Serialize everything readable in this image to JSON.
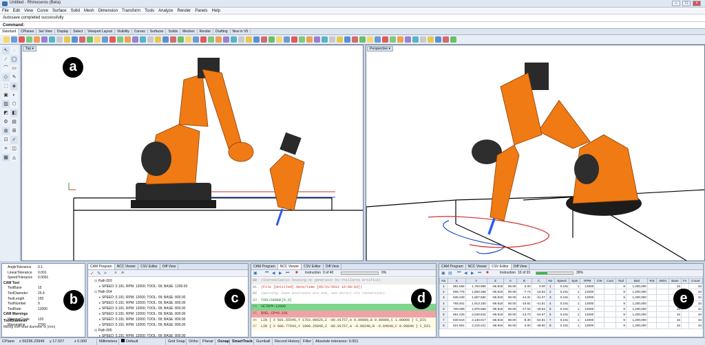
{
  "window": {
    "title": "Untitled - Rhinoceros (Beta)"
  },
  "menu": [
    "File",
    "Edit",
    "View",
    "Curve",
    "Surface",
    "Solid",
    "Mesh",
    "Dimension",
    "Transform",
    "Tools",
    "Analyze",
    "Render",
    "Panels",
    "Help"
  ],
  "command_history": "Autosave completed successfully",
  "command_prompt": "Command:",
  "toolbar_tabs": [
    "Standard",
    "CPlanes",
    "Set View",
    "Display",
    "Select",
    "Viewport Layout",
    "Visibility",
    "Curves",
    "Surfaces",
    "Solids",
    "Meshes",
    "Render",
    "Drafting",
    "New in V5"
  ],
  "viewports": {
    "left": "Top",
    "right": "Perspective"
  },
  "callouts": [
    "a",
    "b",
    "c",
    "d",
    "e"
  ],
  "properties": {
    "rows": [
      {
        "key": "AngleTolerance",
        "value": "0.1",
        "type": "row"
      },
      {
        "key": "LinearTolerance",
        "value": "0.001",
        "type": "row"
      },
      {
        "key": "SpeedTolerance",
        "value": "0.0001",
        "type": "row"
      },
      {
        "key": "CAM Tool",
        "value": "",
        "type": "sec"
      },
      {
        "key": "ToolBase",
        "value": "15",
        "type": "row"
      },
      {
        "key": "ToolDiameter",
        "value": "25.4",
        "type": "row"
      },
      {
        "key": "ToolLength",
        "value": "150",
        "type": "row"
      },
      {
        "key": "ToolNumber",
        "value": "9",
        "type": "row"
      },
      {
        "key": "ToolRate",
        "value": "12000",
        "type": "row"
      },
      {
        "key": "CAM Warnings",
        "value": "",
        "type": "sec"
      },
      {
        "key": "WarningCrank",
        "value": "120",
        "type": "row"
      },
      {
        "key": "WarningFar",
        "value": "2700",
        "type": "row"
      }
    ],
    "desc_title": "ToolDiameter",
    "desc_text": "Milling tool head diameter in (mm)"
  },
  "cam_panel": {
    "tabs": [
      "CAM Program",
      "NCC Viewer",
      "CSV Editor",
      "Diff View"
    ],
    "tree": [
      {
        "indent": 1,
        "text": "Path 003"
      },
      {
        "indent": 2,
        "text": "SPEED: 0.191; RPM: 12000; TOOL: 09; BASE: 1200.00"
      },
      {
        "indent": 1,
        "text": "Path 004"
      },
      {
        "indent": 2,
        "text": "SPEED: 0.191; RPM: 12000; TOOL: 09; BASE: 800.00"
      },
      {
        "indent": 2,
        "text": "SPEED: 0.191; RPM: 12000; TOOL: 09; BASE: 800.00"
      },
      {
        "indent": 2,
        "text": "SPEED: 0.191; RPM: 12000; TOOL: 09; BASE: 800.00"
      },
      {
        "indent": 2,
        "text": "SPEED: 0.191; RPM: 12000; TOOL: 09; BASE: 800.00"
      },
      {
        "indent": 2,
        "text": "SPEED: 0.191; RPM: 12000; TOOL: 09; BASE: 800.00"
      },
      {
        "indent": 2,
        "text": "SPEED: 0.191; RPM: 12000; TOOL: 09; BASE: 800.00"
      },
      {
        "indent": 1,
        "text": "Path 005"
      },
      {
        "indent": 2,
        "text": "SPEED: 0.191; RPM: 12000; TOOL: 09; BASE: 800.00"
      },
      {
        "indent": 2,
        "text": "SPEED: 0.191; RPM: 12000; TOOL: 09; BASE: 800.00"
      }
    ]
  },
  "ncc_panel": {
    "tabs": [
      "CAM Program",
      "NCC Viewer",
      "CSV Editor",
      "Diff View"
    ],
    "instruction": "Instruction",
    "instruction_count": "0 of 40",
    "progress_text": "0%",
    "progress_percent": 0,
    "lines": [
      {
        "n": "00",
        "text": "(Stereoplastic housing nc generator by rhillerns Artifice)",
        "bg": "#eeeeee",
        "color": "#999999"
      },
      {
        "n": "01",
        "text": "(File [Untitled] date/time [05/21/2012 16:00:03])",
        "bg": "#ffffff",
        "color": "#c0392b"
      },
      {
        "n": "02",
        "text": "(warning: base positions are 0x0, see direct ctv conversion)",
        "bg": "#ffffff",
        "color": "#aaaaaa"
      },
      {
        "n": "03",
        "text": "TOOLCHANGE[9,0]",
        "bg": "#ffffff",
        "color": "#1e7a3a"
      },
      {
        "n": "04",
        "text": "SETRPM:12000",
        "bg": "#7fd58c",
        "color": "#0b4d1a"
      },
      {
        "n": "05",
        "text": "$VEL.CP=0.191",
        "bg": "#f0a3a6",
        "color": "#7a1018"
      },
      {
        "n": "06",
        "text": "LIN { X 581.55545,Y 1763.98625,Z -86.91757,A 0.00000,B 0.00000,C 1.00000 } C_DIS",
        "bg": "#fffbe6",
        "color": "#333333"
      },
      {
        "n": "07",
        "text": "LIN { X 606.77543,Y 1808.25848,Z -86.91757,A -0.00240,B -0.04640,C 0.99840 } C_DIS",
        "bg": "#fffbe6",
        "color": "#333333"
      }
    ]
  },
  "csv_panel": {
    "tabs": [
      "CAM Program",
      "NCC Viewer",
      "CSV Editor",
      "Diff View"
    ],
    "instruction": "Instruction",
    "instruction_count": "10 of 33",
    "progress_text": "30%",
    "progress_percent": 30,
    "headers": [
      "No",
      "X",
      "Y",
      "Z",
      "A",
      "B",
      "C",
      "No",
      "Speed",
      "Spin",
      "RPM",
      "CW",
      "Cool",
      "Tool",
      "Butt",
      "Rot",
      "Wrist",
      "Base",
      "Fx",
      "Count"
    ],
    "rows": [
      [
        "1",
        "581.555",
        "1,763.986",
        "-86.918",
        "90.00",
        "0.00",
        "0.00",
        "1",
        "0.191",
        "1",
        "12000",
        "",
        "",
        "9",
        "1,200,000",
        "",
        "",
        "15",
        "",
        "34"
      ],
      [
        "2",
        "606.775",
        "1,808.258",
        "-86.918",
        "90.00",
        "-7.73",
        "-16.84",
        "2",
        "0.191",
        "1",
        "12000",
        "",
        "",
        "9",
        "1,200,000",
        "",
        "",
        "15",
        "",
        "34"
      ],
      [
        "3",
        "635.228",
        "1,857.580",
        "-86.918",
        "90.00",
        "-14.31",
        "-31.07",
        "3",
        "0.191",
        "1",
        "12000",
        "",
        "",
        "9",
        "1,200,000",
        "",
        "",
        "15",
        "",
        "34"
      ],
      [
        "4",
        "768.461",
        "1,913.150",
        "-86.918",
        "90.00",
        "-18.81",
        "-41.61",
        "4",
        "0.191",
        "1",
        "12000",
        "",
        "",
        "9",
        "1,200,000",
        "",
        "",
        "15",
        "",
        "34"
      ],
      [
        "5",
        "709.099",
        "1,976.559",
        "-86.918",
        "90.00",
        "-17.04",
        "-49.64",
        "5",
        "0.191",
        "1",
        "12000",
        "",
        "",
        "9",
        "1,200,000",
        "",
        "",
        "15",
        "",
        "34"
      ],
      [
        "6",
        "661.226",
        "2,048.942",
        "-86.918",
        "90.00",
        "-13.73",
        "-54.97",
        "6",
        "0.191",
        "1",
        "12000",
        "",
        "",
        "9",
        "1,200,000",
        "",
        "",
        "15",
        "",
        "34"
      ],
      [
        "7",
        "630.516",
        "2,130.017",
        "-86.918",
        "90.00",
        "-8.30",
        "-54.81",
        "7",
        "0.191",
        "1",
        "12000",
        "",
        "",
        "9",
        "1,200,000",
        "",
        "",
        "15",
        "",
        "34"
      ],
      [
        "8",
        "621.561",
        "2,216.221",
        "-86.918",
        "90.00",
        "0.00",
        "-48.60",
        "8",
        "0.191",
        "1",
        "12000",
        "",
        "",
        "9",
        "1,200,000",
        "",
        "",
        "15",
        "",
        "34"
      ]
    ]
  },
  "status": {
    "cplane": "CPlane",
    "x": "x 56296.23949",
    "y": "y 17.027",
    "z": "z 0.000",
    "units": "Millimeters",
    "layer": "Default",
    "buttons": [
      "Grid Snap",
      "Ortho",
      "Planar",
      "Osnap",
      "SmartTrack",
      "Gumball",
      "Record History",
      "Filter"
    ],
    "tolerance": "Absolute tolerance: 0.001"
  },
  "colors": {
    "robot": "#f07a14",
    "robot_dark": "#2a2a2a",
    "path_red": "#d42a2a",
    "path_blue": "#1e4fc4",
    "tool_tip": "#2a5cf0"
  }
}
